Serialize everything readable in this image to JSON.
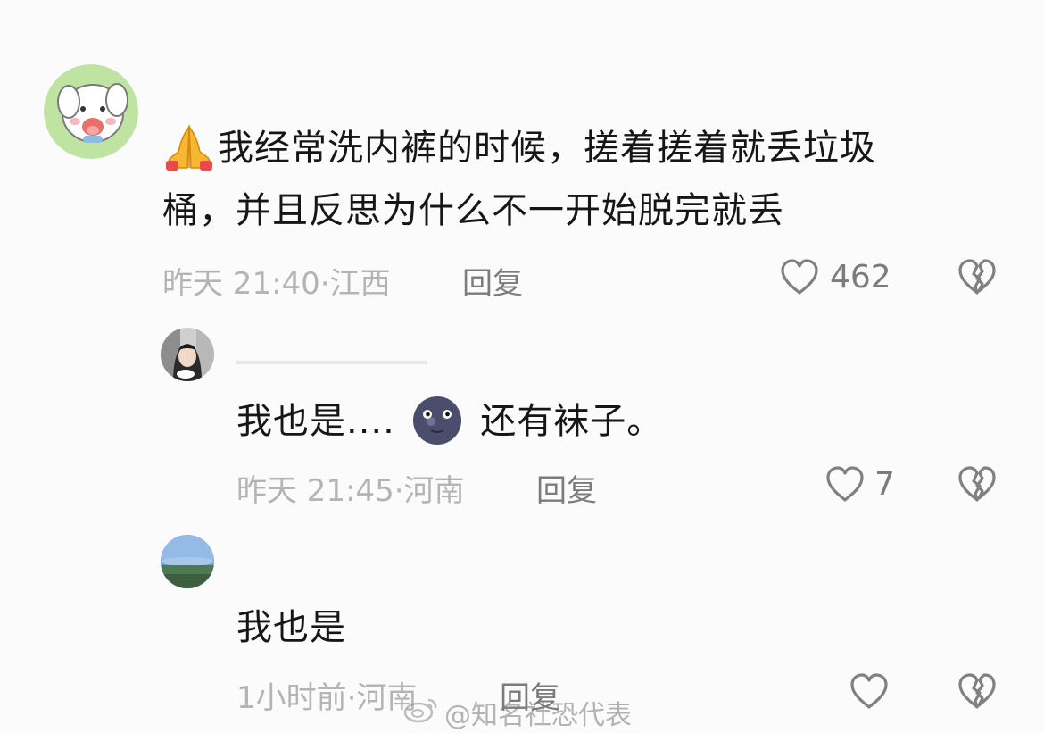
{
  "comments": [
    {
      "text_line1": "我经常洗内裤的时候，搓着搓着就丢垃圾",
      "text_line2": "桶，并且反思为什么不一开始脱完就丢",
      "emoji": "folded-hands",
      "time": "昨天 21:40",
      "location": "江西",
      "reply_label": "回复",
      "likes": "462"
    },
    {
      "text_before_emoji": "我也是....",
      "emoji": "new-moon-face",
      "text_after_emoji": "还有袜子。",
      "time": "昨天 21:45",
      "location": "河南",
      "reply_label": "回复",
      "likes": "7"
    },
    {
      "text": "我也是",
      "time": "1小时前",
      "location": "河南",
      "reply_label": "回复",
      "likes": ""
    }
  ],
  "separator": "·",
  "watermark": "@知名社恐代表",
  "colors": {
    "background": "#fbfbfb",
    "text": "#161616",
    "meta": "#b4b4b4",
    "action": "#7c7c7c"
  }
}
